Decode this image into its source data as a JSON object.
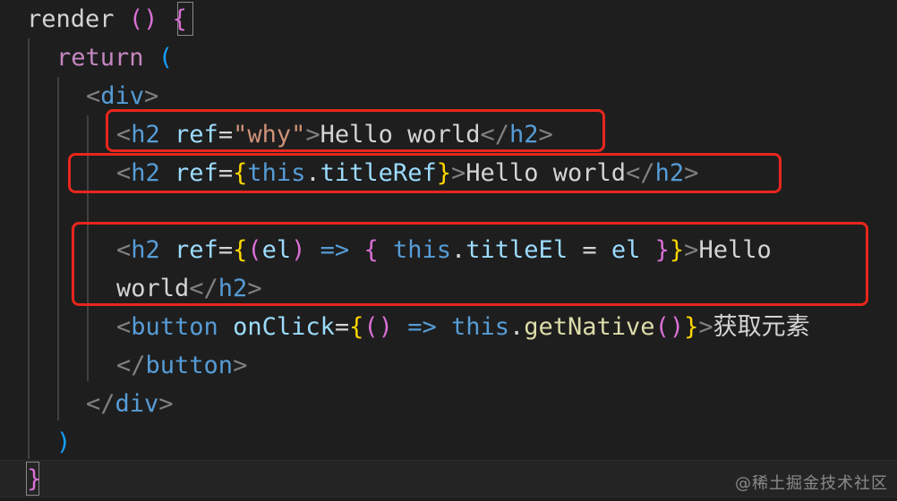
{
  "colors": {
    "background": "#1e1e1e",
    "text": "#d4d4d4",
    "keyword": "#c586c0",
    "tag_bracket": "#808080",
    "tag_name": "#569cd6",
    "attribute": "#9cdcfe",
    "string": "#ce9178",
    "function": "#dcdcaa",
    "bracket_gold": "#ffd700",
    "bracket_violet": "#da70d6",
    "highlight_box": "#e8261d"
  },
  "code": {
    "line_1": {
      "a": "render",
      "b": " ",
      "c": "()",
      "d": " ",
      "e": "{"
    },
    "line_2": {
      "a": "return",
      "b": " ",
      "c": "("
    },
    "line_3": {
      "a": "<",
      "b": "div",
      "c": ">"
    },
    "line_4": {
      "a": "<",
      "b": "h2",
      "c": " ",
      "d": "ref",
      "e": "=",
      "f": "\"why\"",
      "g": ">",
      "h": "Hello world",
      "i": "</",
      "j": "h2",
      "k": ">"
    },
    "line_5": {
      "a": "<",
      "b": "h2",
      "c": " ",
      "d": "ref",
      "e": "=",
      "f": "{",
      "g": "this",
      "h": ".",
      "i": "titleRef",
      "j": "}",
      "k": ">",
      "l": "Hello world",
      "m": "</",
      "n": "h2",
      "o": ">"
    },
    "line_7": {
      "a": "<",
      "b": "h2",
      "c": " ",
      "d": "ref",
      "e": "=",
      "f": "{",
      "g": "(",
      "h": "el",
      "i": ")",
      "j": " ",
      "k": "=>",
      "l": " ",
      "m": "{",
      "n": " ",
      "o": "this",
      "p": ".",
      "q": "titleEl",
      "r": " = ",
      "s": "el",
      "t": " ",
      "u": "}",
      "v": "}",
      "w": ">",
      "x": "Hello"
    },
    "line_8": {
      "a": "world",
      "b": "</",
      "c": "h2",
      "d": ">"
    },
    "line_9": {
      "a": "<",
      "b": "button",
      "c": " ",
      "d": "onClick",
      "e": "=",
      "f": "{",
      "g": "()",
      "h": " ",
      "i": "=>",
      "j": " ",
      "k": "this",
      "l": ".",
      "m": "getNative",
      "n": "()",
      "o": "}",
      "p": ">",
      "q": "获取元素"
    },
    "line_10": {
      "a": "</",
      "b": "button",
      "c": ">"
    },
    "line_11": {
      "a": "</",
      "b": "div",
      "c": ">"
    },
    "line_12": {
      "a": ")"
    },
    "line_13": {
      "a": "}"
    }
  },
  "watermark": "@稀土掘金技术社区"
}
